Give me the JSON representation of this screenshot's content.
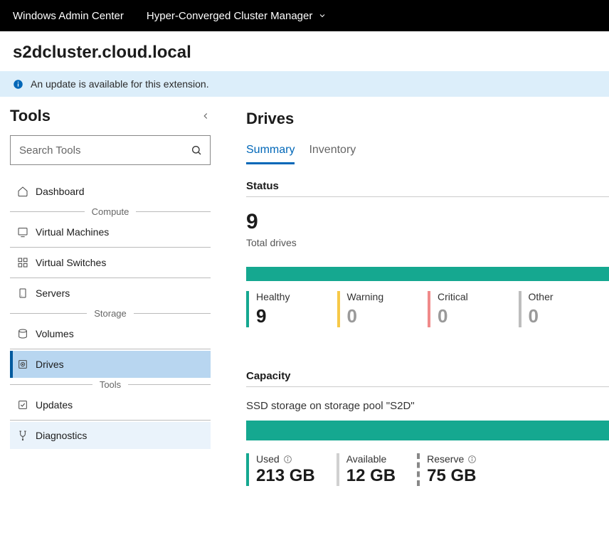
{
  "topbar": {
    "brand": "Windows Admin Center",
    "context": "Hyper-Converged Cluster Manager"
  },
  "cluster_name": "s2dcluster.cloud.local",
  "notice": {
    "text": "An update is available for this extension."
  },
  "sidebar": {
    "title": "Tools",
    "search_placeholder": "Search Tools",
    "groups": {
      "compute_label": "Compute",
      "storage_label": "Storage",
      "tools_label": "Tools"
    },
    "items": {
      "dashboard": "Dashboard",
      "virtual_machines": "Virtual Machines",
      "virtual_switches": "Virtual Switches",
      "servers": "Servers",
      "volumes": "Volumes",
      "drives": "Drives",
      "updates": "Updates",
      "diagnostics": "Diagnostics"
    }
  },
  "main": {
    "title": "Drives",
    "tabs": {
      "summary": "Summary",
      "inventory": "Inventory"
    },
    "status": {
      "heading": "Status",
      "total_value": "9",
      "total_label": "Total drives",
      "healthy": {
        "label": "Healthy",
        "value": "9"
      },
      "warning": {
        "label": "Warning",
        "value": "0"
      },
      "critical": {
        "label": "Critical",
        "value": "0"
      },
      "other": {
        "label": "Other",
        "value": "0"
      }
    },
    "capacity": {
      "heading": "Capacity",
      "description": "SSD storage on storage pool \"S2D\"",
      "used": {
        "label": "Used",
        "value": "213 GB"
      },
      "available": {
        "label": "Available",
        "value": "12 GB"
      },
      "reserve": {
        "label": "Reserve",
        "value": "75 GB"
      }
    }
  }
}
